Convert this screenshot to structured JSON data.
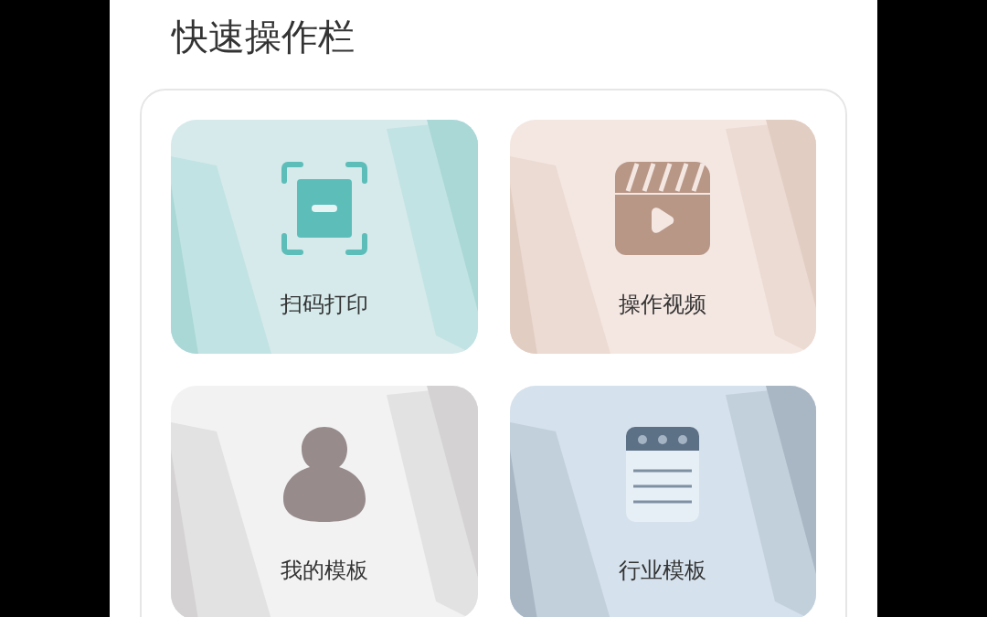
{
  "section_title": "快速操作栏",
  "actions": [
    {
      "kind": "scan",
      "label": "扫码打印"
    },
    {
      "kind": "video",
      "label": "操作视频"
    },
    {
      "kind": "person",
      "label": "我的模板"
    },
    {
      "kind": "document",
      "label": "行业模板"
    }
  ]
}
